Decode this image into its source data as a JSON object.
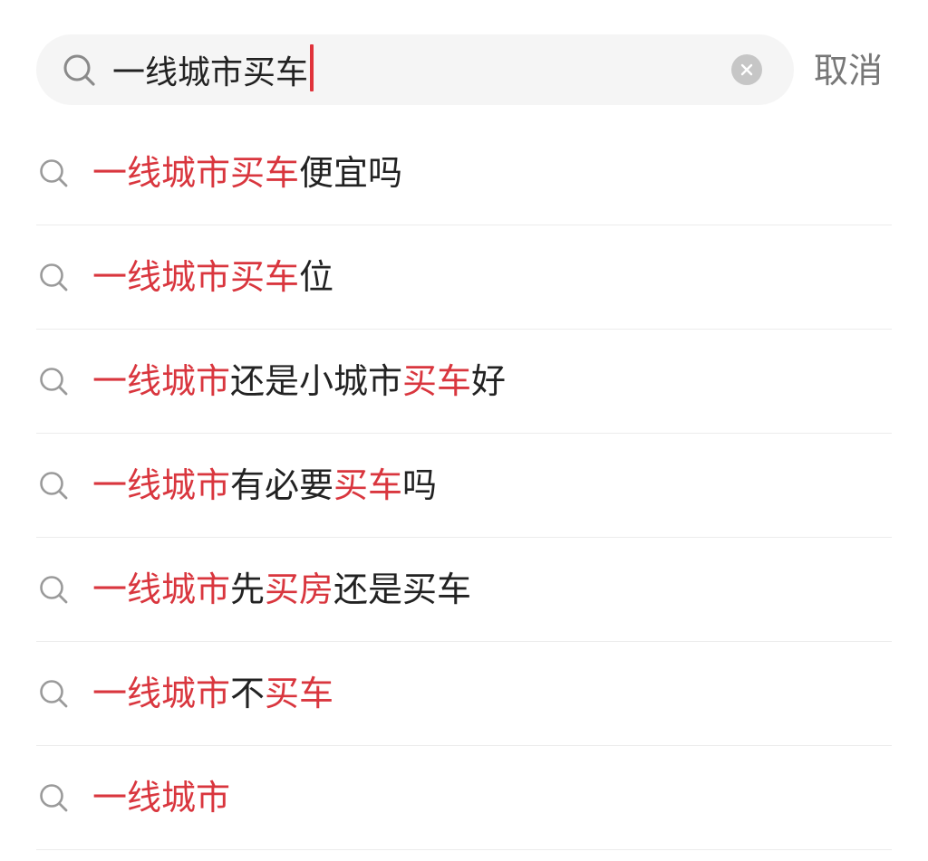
{
  "search": {
    "value": "一线城市买车",
    "cancel_label": "取消"
  },
  "colors": {
    "highlight": "#d9363e",
    "caret": "#e0333b",
    "text": "#222222",
    "muted": "#777777",
    "search_bg": "#f5f5f5"
  },
  "icons": {
    "search": "search-icon",
    "clear": "clear-icon",
    "suggestion": "search-icon"
  },
  "suggestions": [
    {
      "segments": [
        {
          "text": "一线城市买车",
          "highlight": true
        },
        {
          "text": "便宜吗",
          "highlight": false
        }
      ]
    },
    {
      "segments": [
        {
          "text": "一线城市买车",
          "highlight": true
        },
        {
          "text": "位",
          "highlight": false
        }
      ]
    },
    {
      "segments": [
        {
          "text": "一线城市",
          "highlight": true
        },
        {
          "text": "还是小城市",
          "highlight": false
        },
        {
          "text": "买车",
          "highlight": true
        },
        {
          "text": "好",
          "highlight": false
        }
      ]
    },
    {
      "segments": [
        {
          "text": "一线城市",
          "highlight": true
        },
        {
          "text": "有必要",
          "highlight": false
        },
        {
          "text": "买车",
          "highlight": true
        },
        {
          "text": "吗",
          "highlight": false
        }
      ]
    },
    {
      "segments": [
        {
          "text": "一线城市",
          "highlight": true
        },
        {
          "text": "先",
          "highlight": false
        },
        {
          "text": "买房",
          "highlight": true
        },
        {
          "text": "还是买车",
          "highlight": false
        }
      ]
    },
    {
      "segments": [
        {
          "text": "一线城市",
          "highlight": true
        },
        {
          "text": "不",
          "highlight": false
        },
        {
          "text": "买车",
          "highlight": true
        }
      ]
    },
    {
      "segments": [
        {
          "text": "一线城市",
          "highlight": true
        }
      ]
    }
  ]
}
